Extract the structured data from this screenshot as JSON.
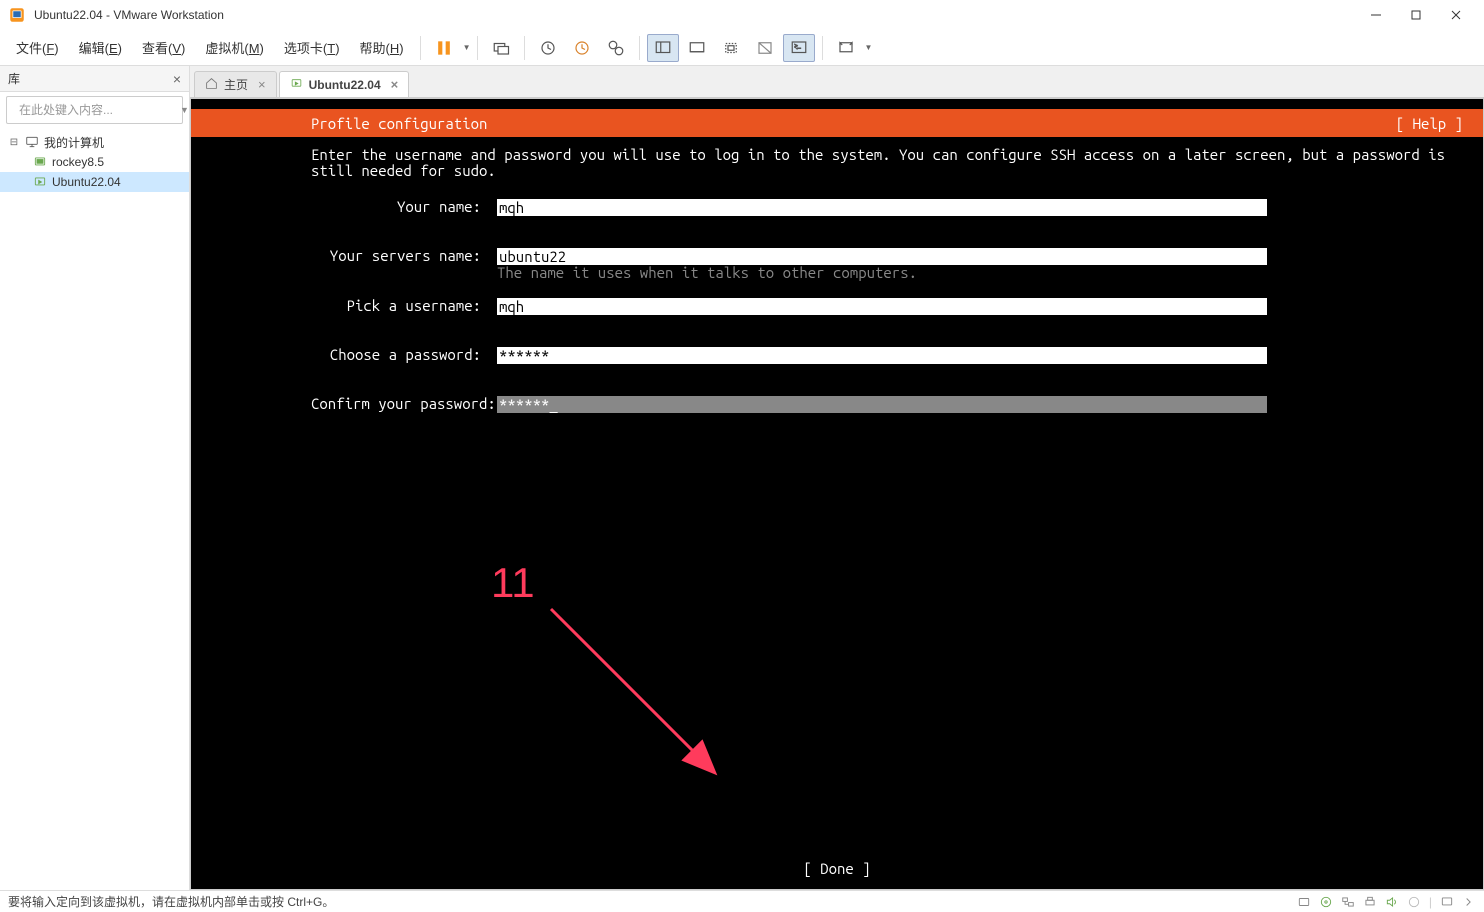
{
  "window": {
    "title": "Ubuntu22.04 - VMware Workstation"
  },
  "menubar": {
    "items": [
      {
        "label": "文件(",
        "ul": "F",
        "tail": ")"
      },
      {
        "label": "编辑(",
        "ul": "E",
        "tail": ")"
      },
      {
        "label": "查看(",
        "ul": "V",
        "tail": ")"
      },
      {
        "label": "虚拟机(",
        "ul": "M",
        "tail": ")"
      },
      {
        "label": "选项卡(",
        "ul": "T",
        "tail": ")"
      },
      {
        "label": "帮助(",
        "ul": "H",
        "tail": ")"
      }
    ]
  },
  "sidebar": {
    "title": "库",
    "search_placeholder": "在此处键入内容...",
    "tree": {
      "root": "我的计算机",
      "children": [
        {
          "label": "rockey8.5",
          "selected": false
        },
        {
          "label": "Ubuntu22.04",
          "selected": true
        }
      ]
    }
  },
  "tabs": [
    {
      "label": "主页",
      "active": false,
      "icon": "home"
    },
    {
      "label": "Ubuntu22.04",
      "active": true,
      "icon": "vm"
    }
  ],
  "vm": {
    "header_title": "Profile configuration",
    "help_label": "[ Help ]",
    "instructions": "Enter the username and password you will use to log in to the system. You can configure SSH access on a later screen, but a password is still needed for sudo.",
    "fields": {
      "your_name": {
        "label": "Your name:",
        "value": "mqh"
      },
      "server_name": {
        "label": "Your servers name:",
        "value": "ubuntu22",
        "hint": "The name it uses when it talks to other computers."
      },
      "username": {
        "label": "Pick a username:",
        "value": "mqh"
      },
      "password": {
        "label": "Choose a password:",
        "value": "******"
      },
      "confirm": {
        "label": "Confirm your password:",
        "value": "******_"
      }
    },
    "done_label": "[ Done          ]"
  },
  "annotation": {
    "number": "11"
  },
  "statusbar": {
    "text": "要将输入定向到该虚拟机，请在虚拟机内部单击或按 Ctrl+G。"
  }
}
